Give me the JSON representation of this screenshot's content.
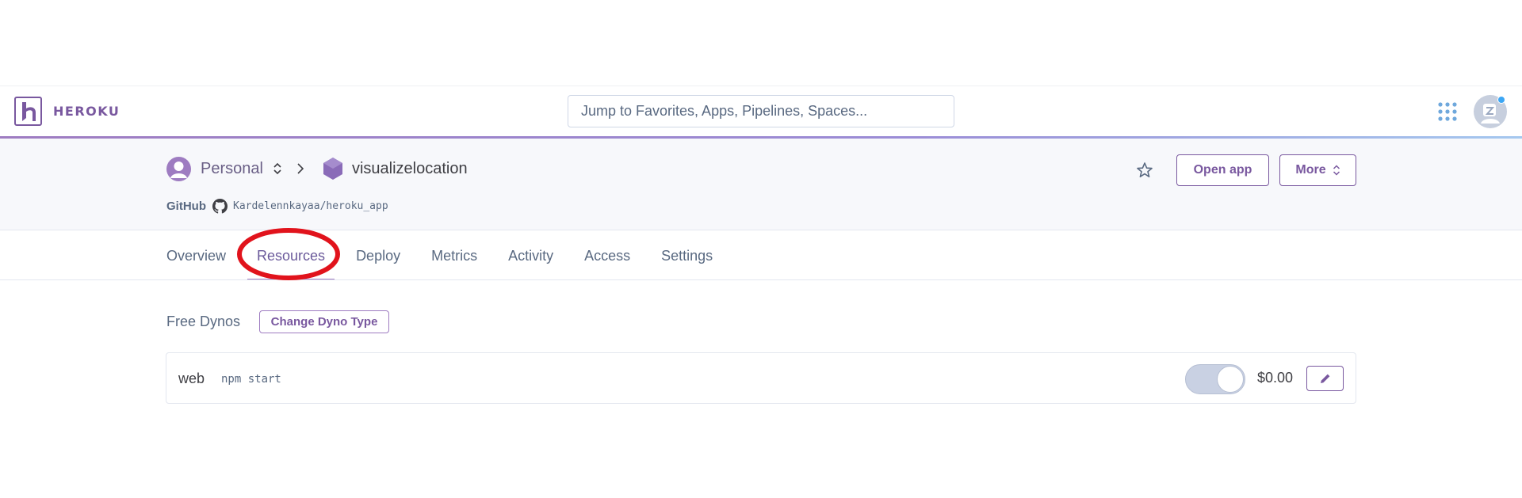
{
  "header": {
    "brand": "HEROKU",
    "search_placeholder": "Jump to Favorites, Apps, Pipelines, Spaces...",
    "icons": [
      "heroku-logo-icon",
      "apps-grid-icon",
      "user-avatar-icon"
    ]
  },
  "app": {
    "owner": "Personal",
    "name": "visualizelocation",
    "source_label": "GitHub",
    "repo": "Kardelennkayaa/heroku_app",
    "open_app_label": "Open app",
    "more_label": "More"
  },
  "tabs": [
    {
      "label": "Overview",
      "active": false
    },
    {
      "label": "Resources",
      "active": true
    },
    {
      "label": "Deploy",
      "active": false
    },
    {
      "label": "Metrics",
      "active": false
    },
    {
      "label": "Activity",
      "active": false
    },
    {
      "label": "Access",
      "active": false
    },
    {
      "label": "Settings",
      "active": false
    }
  ],
  "annotation": {
    "color": "#e1131c",
    "target": "Resources"
  },
  "dynos": {
    "heading": "Free Dynos",
    "change_label": "Change Dyno Type",
    "rows": [
      {
        "type": "web",
        "command": "npm start",
        "price": "$0.00",
        "enabled": false
      }
    ]
  },
  "colors": {
    "brand_purple": "#79589f",
    "text_slate": "#596981",
    "band_bg": "#f7f8fb",
    "notification": "#3ba6f4"
  }
}
